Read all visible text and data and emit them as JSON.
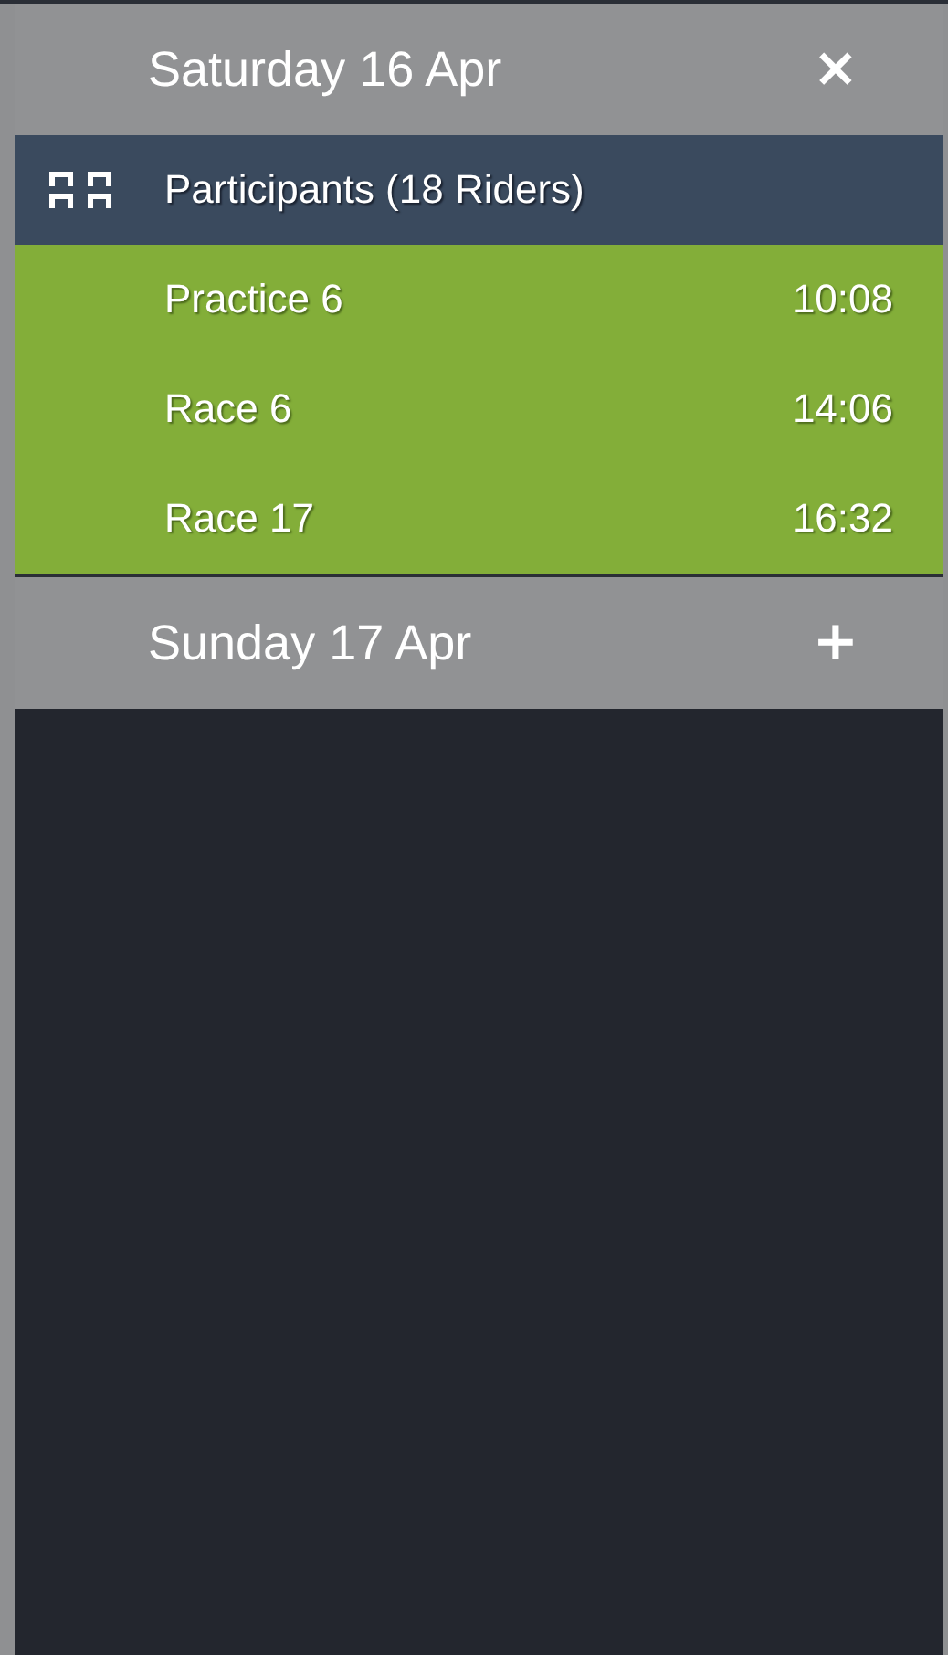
{
  "days": [
    {
      "title": "Saturday 16 Apr",
      "expanded": true,
      "toggle": "×",
      "items": [
        {
          "kind": "participants",
          "label": "Participants (18 Riders)"
        },
        {
          "kind": "session",
          "label": "Practice 6",
          "time": "10:08"
        },
        {
          "kind": "session",
          "label": "Race 6",
          "time": "14:06"
        },
        {
          "kind": "session",
          "label": "Race 17",
          "time": "16:32"
        }
      ]
    },
    {
      "title": "Sunday 17 Apr",
      "expanded": false,
      "toggle": "+"
    }
  ]
}
